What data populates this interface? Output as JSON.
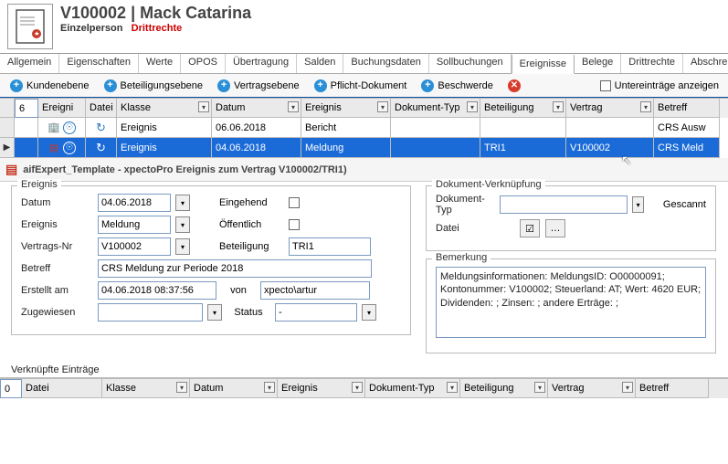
{
  "header": {
    "title": "V100002 | Mack Catarina",
    "subtype": "Einzelperson",
    "rights": "Drittrechte"
  },
  "tabs": {
    "items": [
      "Allgemein",
      "Eigenschaften",
      "Werte",
      "OPOS",
      "Übertragung",
      "Salden",
      "Buchungsdaten",
      "Sollbuchungen",
      "Ereignisse",
      "Belege",
      "Drittrechte",
      "Abschreibungen"
    ],
    "active_index": 8
  },
  "toolbar": {
    "kundenebene": "Kundenebene",
    "beteiligungsebene": "Beteiligungsebene",
    "vertragsebene": "Vertragsebene",
    "pflicht": "Pflicht-Dokument",
    "beschwerde": "Beschwerde",
    "untereintraege": "Untereinträge anzeigen"
  },
  "grid": {
    "count": "6",
    "headers": {
      "ereigni": "Ereigni",
      "datei": "Datei",
      "klasse": "Klasse",
      "datum": "Datum",
      "ereignis": "Ereignis",
      "doktyp": "Dokument-Typ",
      "beteiligung": "Beteiligung",
      "vertrag": "Vertrag",
      "betreff": "Betreff"
    },
    "rows": [
      {
        "klasse": "Ereignis",
        "datum": "06.06.2018",
        "ereignis": "Bericht",
        "doktyp": "",
        "beteiligung": "",
        "vertrag": "",
        "betreff": "CRS Ausw"
      },
      {
        "klasse": "Ereignis",
        "datum": "04.06.2018",
        "ereignis": "Meldung",
        "doktyp": "",
        "beteiligung": "TRI1",
        "vertrag": "V100002",
        "betreff": "CRS Meld"
      }
    ]
  },
  "group_title": "aifExpert_Template - xpectoPro Ereignis zum Vertrag V100002/TRI1)",
  "form": {
    "legend_left": "Ereignis",
    "datum_label": "Datum",
    "datum": "04.06.2018",
    "eingehend_label": "Eingehend",
    "oeffentlich_label": "Öffentlich",
    "ereignis_label": "Ereignis",
    "ereignis": "Meldung",
    "vertragsnr_label": "Vertrags-Nr",
    "vertragsnr": "V100002",
    "beteiligung_label": "Beteiligung",
    "beteiligung": "TRI1",
    "betreff_label": "Betreff",
    "betreff": "CRS Meldung zur Periode 2018",
    "erstellt_label": "Erstellt am",
    "erstellt": "04.06.2018 08:37:56",
    "von_label": "von",
    "von": "xpecto\\artur",
    "zugewiesen_label": "Zugewiesen",
    "status_label": "Status",
    "status": "-",
    "legend_right": "Dokument-Verknüpfung",
    "doktyp_label": "Dokument-Typ",
    "gescannt_label": "Gescannt",
    "datei_label": "Datei",
    "bemerkung_label": "Bemerkung",
    "bemerkung": "Meldungsinformationen: MeldungsID: O00000091; Kontonummer: V100002; Steuerland: AT; Wert: 4620 EUR; Dividenden: ; Zinsen: ; andere Erträge: ;"
  },
  "linked": {
    "title": "Verknüpfte Einträge",
    "count": "0",
    "headers": {
      "datei": "Datei",
      "klasse": "Klasse",
      "datum": "Datum",
      "ereignis": "Ereignis",
      "doktyp": "Dokument-Typ",
      "beteiligung": "Beteiligung",
      "vertrag": "Vertrag",
      "betreff": "Betreff"
    }
  }
}
